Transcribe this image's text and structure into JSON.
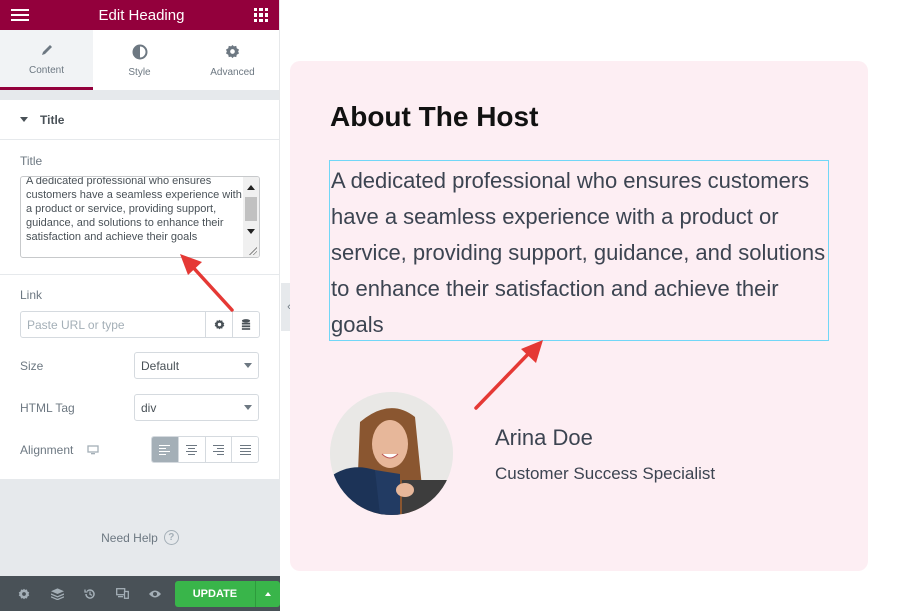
{
  "panel": {
    "title": "Edit Heading",
    "tabs": [
      {
        "label": "Content",
        "icon": "pencil-icon",
        "active": true
      },
      {
        "label": "Style",
        "icon": "half-circle-icon",
        "active": false
      },
      {
        "label": "Advanced",
        "icon": "gear-icon",
        "active": false
      }
    ],
    "section_title": "Title",
    "title_field": {
      "label": "Title",
      "value": "A dedicated professional who ensures customers have a seamless experience with a product or service, providing support, guidance, and solutions to enhance their satisfaction and achieve their goals"
    },
    "link_field": {
      "label": "Link",
      "placeholder": "Paste URL or type"
    },
    "size_field": {
      "label": "Size",
      "value": "Default"
    },
    "html_tag_field": {
      "label": "HTML Tag",
      "value": "div"
    },
    "alignment_field": {
      "label": "Alignment",
      "options": [
        "left",
        "center",
        "right",
        "justify"
      ],
      "selected": "left"
    },
    "help_text": "Need Help",
    "footer": {
      "icons": [
        "settings-icon",
        "navigator-icon",
        "history-icon",
        "responsive-icon",
        "preview-icon"
      ],
      "update_label": "UPDATE"
    }
  },
  "preview": {
    "heading": "About The Host",
    "description": "A dedicated professional who ensures customers have a seamless experience with a product or service, providing support, guidance, and solutions to enhance their satisfaction and achieve their goals",
    "person_name": "Arina Doe",
    "person_role": "Customer Success Specialist"
  },
  "colors": {
    "brand": "#93003c",
    "update_green": "#39b54a",
    "card_background": "#fdeef3",
    "selection_outline": "#71d7f7",
    "annotation_arrow": "#e53935"
  }
}
